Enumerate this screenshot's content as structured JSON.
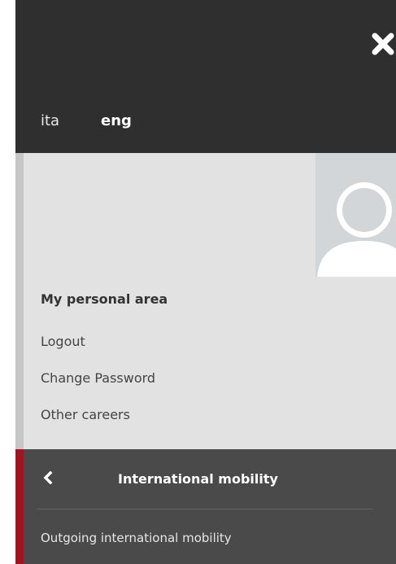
{
  "header": {
    "close_icon": "close-icon",
    "languages": [
      {
        "label": "ita",
        "active": false
      },
      {
        "label": "eng",
        "active": true
      }
    ]
  },
  "user_area": {
    "avatar_icon": "user-avatar-icon",
    "title": "My personal area",
    "links": [
      "Logout",
      "Change Password",
      "Other careers"
    ]
  },
  "menu": {
    "back_icon": "chevron-left-icon",
    "title": "International mobility",
    "items": [
      "Outgoing international mobility"
    ]
  },
  "colors": {
    "header_bg": "#2f2f2f",
    "user_area_bg": "#e2e2e2",
    "menu_bg": "#4a4a4a",
    "accent": "#a4131d"
  }
}
